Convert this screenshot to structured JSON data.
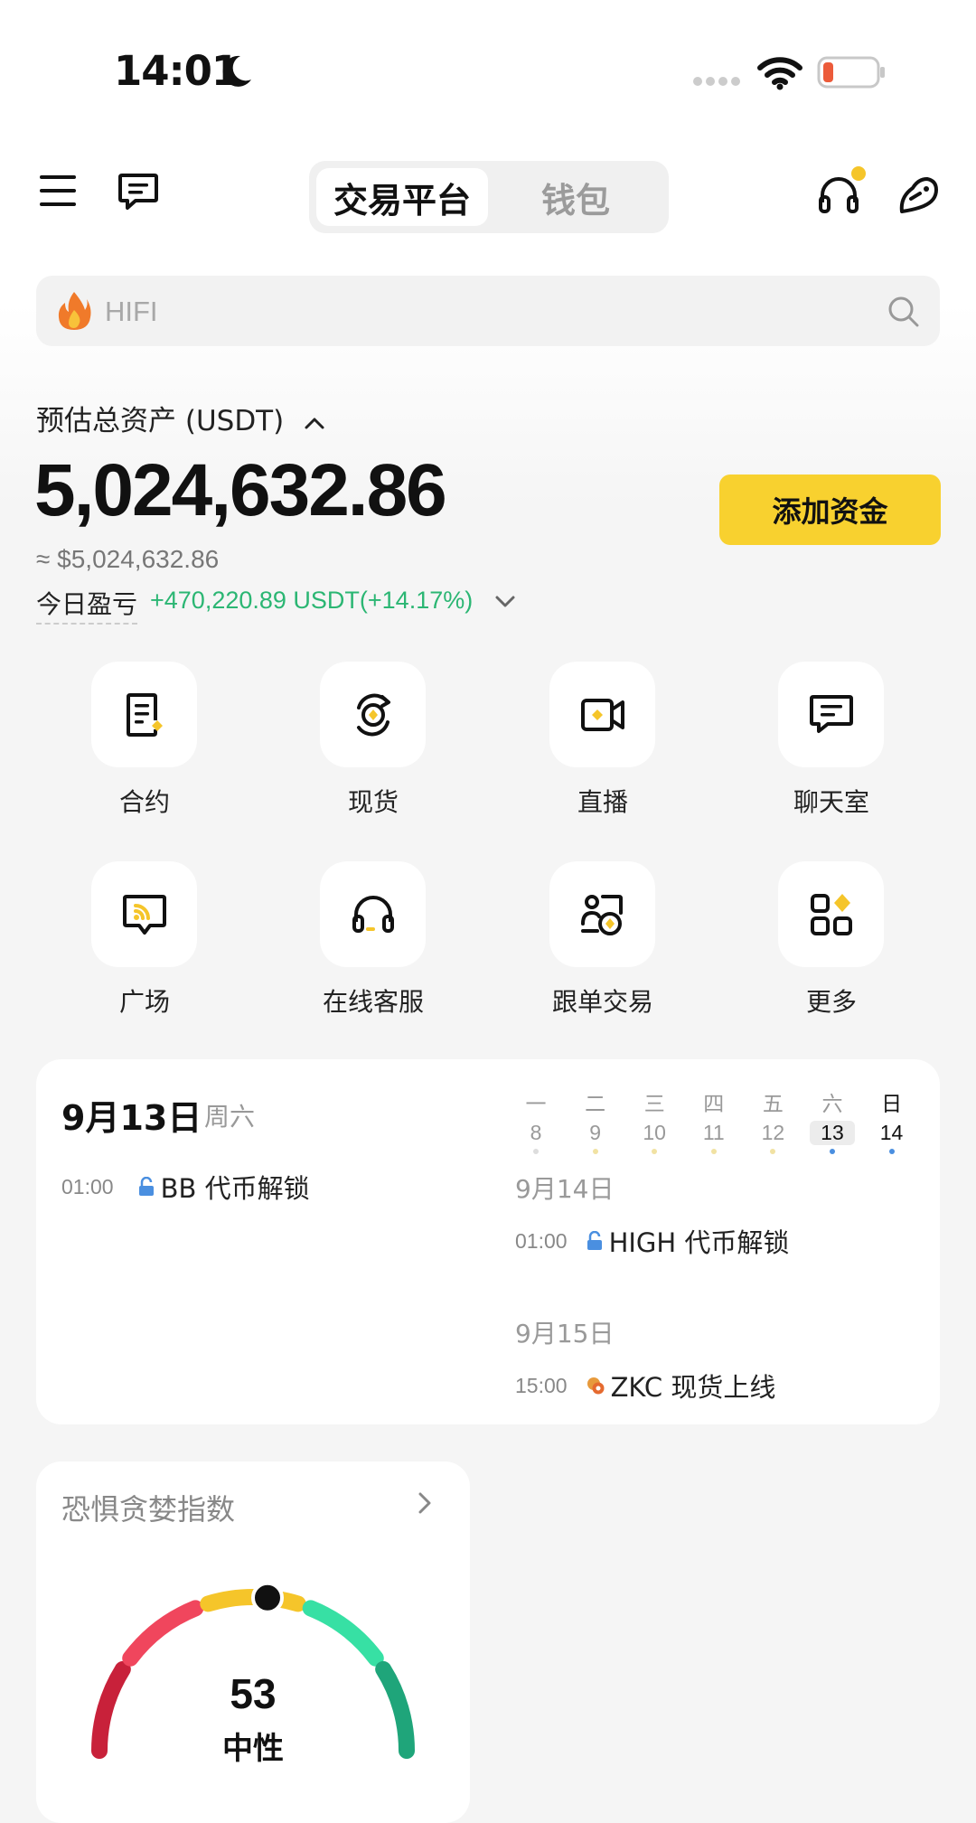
{
  "status_bar": {
    "time": "14:01"
  },
  "header": {
    "tabs": [
      {
        "label": "交易平台"
      },
      {
        "label": "钱包"
      }
    ]
  },
  "search": {
    "placeholder": "HIFI"
  },
  "assets": {
    "label": "预估总资产 (USDT)",
    "value": "5,024,632.86",
    "approx": "≈ $5,024,632.86",
    "pnl_label": "今日盈亏",
    "pnl_value": "+470,220.89 USDT(+14.17%)",
    "add_funds": "添加资金"
  },
  "shortcuts": [
    {
      "label": "合约",
      "icon": "contract-icon"
    },
    {
      "label": "现货",
      "icon": "spot-icon"
    },
    {
      "label": "直播",
      "icon": "live-icon"
    },
    {
      "label": "聊天室",
      "icon": "chat-icon"
    },
    {
      "label": "广场",
      "icon": "square-icon"
    },
    {
      "label": "在线客服",
      "icon": "support-icon"
    },
    {
      "label": "跟单交易",
      "icon": "copy-trade-icon"
    },
    {
      "label": "更多",
      "icon": "more-icon"
    }
  ],
  "calendar": {
    "date": "9月13日",
    "weekday": "周六",
    "today_events": [
      {
        "time": "01:00",
        "text": "BB 代币解锁"
      }
    ],
    "week": [
      {
        "day": "一",
        "num": "8"
      },
      {
        "day": "二",
        "num": "9"
      },
      {
        "day": "三",
        "num": "10"
      },
      {
        "day": "四",
        "num": "11"
      },
      {
        "day": "五",
        "num": "12"
      },
      {
        "day": "六",
        "num": "13"
      },
      {
        "day": "日",
        "num": "14"
      }
    ],
    "upcoming": [
      {
        "date": "9月14日",
        "time": "01:00",
        "text": "HIGH 代币解锁"
      },
      {
        "date": "9月15日",
        "time": "15:00",
        "text": "ZKC 现货上线"
      }
    ]
  },
  "fear_greed": {
    "title": "恐惧贪婪指数",
    "value": "53",
    "label": "中性",
    "level": 53
  },
  "colors": {
    "accent": "#f8d12f",
    "profit": "#2bb673",
    "fear_dark": "#c8213a",
    "fear": "#f0465d",
    "neutral": "#f5c52a",
    "greed": "#37e0a4",
    "greed_dark": "#1fa57a"
  }
}
